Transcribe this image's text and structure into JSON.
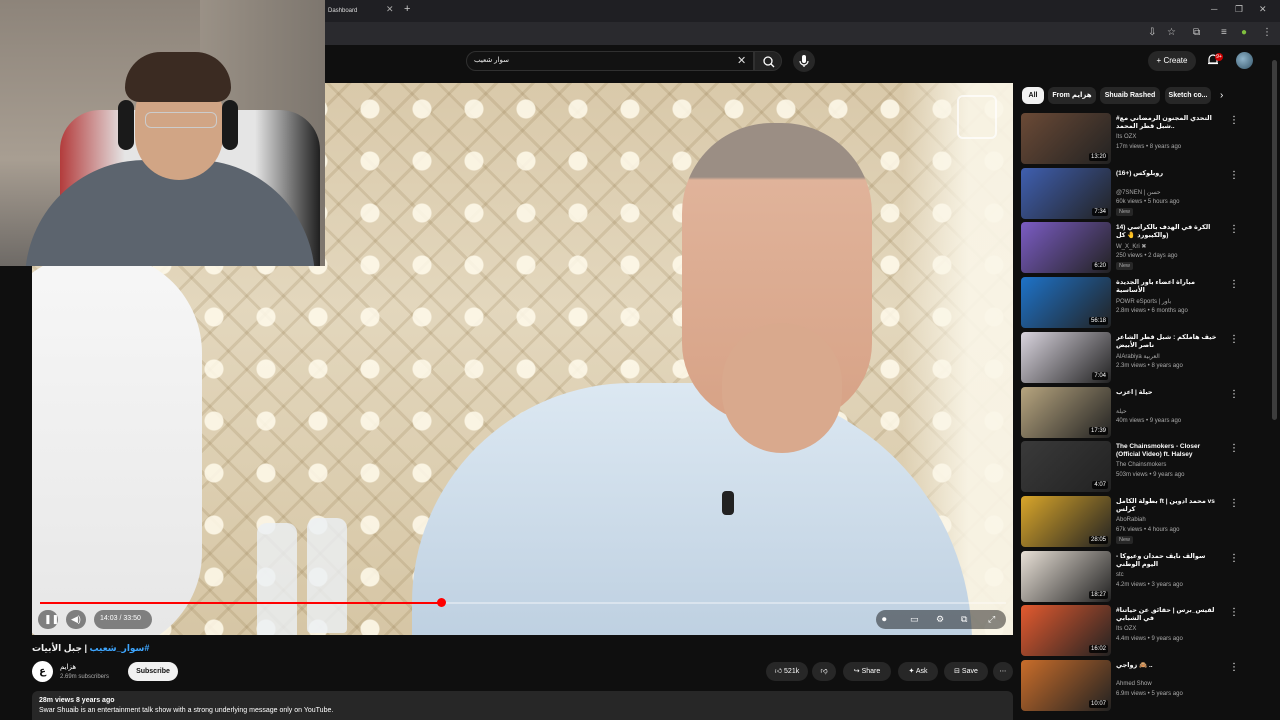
{
  "browser": {
    "tab_title": "Dashboard",
    "tab_close": "✕",
    "new_tab": "+",
    "win_minimize": "─",
    "win_restore": "❐",
    "win_close": "✕"
  },
  "header": {
    "search_value": "سوار شعيب",
    "create_label": "Create",
    "notification_count": "9+"
  },
  "player": {
    "current_time": "14:03",
    "duration": "33:50",
    "time_text": "14:03 / 33:50",
    "progress_fraction": 0.415
  },
  "video": {
    "title_prefix": "| جبل الأبيات",
    "title_hashtag": "#سوار_شعيب",
    "channel_initial": "ع",
    "channel_name": "هزايم",
    "subscribers": "2.69m subscribers",
    "subscribe_label": "Subscribe",
    "likes": "521k",
    "share_label": "Share",
    "ask_label": "Ask",
    "save_label": "Save",
    "meta": "28m views  8 years ago",
    "description": "Swar Shuaib is an entertainment talk show with a strong underlying message only on YouTube."
  },
  "chips": [
    {
      "label": "All"
    },
    {
      "label": "From هزايم"
    },
    {
      "label": "Shuaib Rashed"
    },
    {
      "label": "Sketch co..."
    }
  ],
  "recommendations": [
    {
      "title": "#التحدي المجنون الرمضاني مع شبل قطر المحمد..",
      "channel": "Its OZX",
      "stats": "17m views • 8 years ago",
      "duration": "13:20",
      "badge": "",
      "color": "#6b4a36"
    },
    {
      "title": "(16+) روبلوكس",
      "channel": "@7SNEN | حسن",
      "stats": "60k views • 5 hours ago",
      "duration": "7:34",
      "badge": "New",
      "color": "#3f5fb0"
    },
    {
      "title": "14) الكرة في الهدف بالكراسي والكيبورد 🤚 كل)",
      "channel": "W_X_Kri ✖",
      "stats": "250 views • 2 days ago",
      "duration": "6:20",
      "badge": "New",
      "color": "#7b5cc4"
    },
    {
      "title": "مباراة أعضاء باور الجديدة الأساسية",
      "channel": "POWR eSports | باور",
      "stats": "2.8m views • 6 months ago",
      "duration": "56:18",
      "badge": "",
      "color": "#1e73c9"
    },
    {
      "title": "خيف هاملكم : شبل قطر الشاعر ناصر الأبيض",
      "channel": "AlArabiya العربية",
      "stats": "2.3m views • 8 years ago",
      "duration": "7:04",
      "badge": "",
      "color": "#d9d4de"
    },
    {
      "title": "حيلة | أعزب",
      "channel": "حيلة",
      "stats": "40m views • 9 years ago",
      "duration": "17:39",
      "badge": "",
      "color": "#b7a57f"
    },
    {
      "title": "The Chainsmokers - Closer (Official Video) ft. Halsey",
      "channel": "The Chainsmokers",
      "stats": "503m views • 9 years ago",
      "duration": "4:07",
      "badge": "",
      "color": "#3a3a3a"
    },
    {
      "title": "بطولة الكامل ft | محمد ادوين vs كرلس",
      "channel": "AboRabiah",
      "stats": "67k views • 4 hours ago",
      "duration": "28:05",
      "badge": "New",
      "color": "#d9a62a"
    },
    {
      "title": "سوالف نايف حمدان وعيوكا - اليوم الوطني",
      "channel": "stc",
      "stats": "4.2m views • 3 years ago",
      "duration": "18:27",
      "badge": "",
      "color": "#e8e0d6"
    },
    {
      "title": "#لقيس_برس | حقائق عن حياتنا في الشبابي",
      "channel": "Its OZX",
      "stats": "4.4m views • 9 years ago",
      "duration": "16:02",
      "badge": "",
      "color": "#e35a2f"
    },
    {
      "title": "زواجي 🙈 ..",
      "channel": "Ahmed Show",
      "stats": "6.9m views • 5 years ago",
      "duration": "10:07",
      "badge": "",
      "color": "#c96d2a"
    }
  ]
}
